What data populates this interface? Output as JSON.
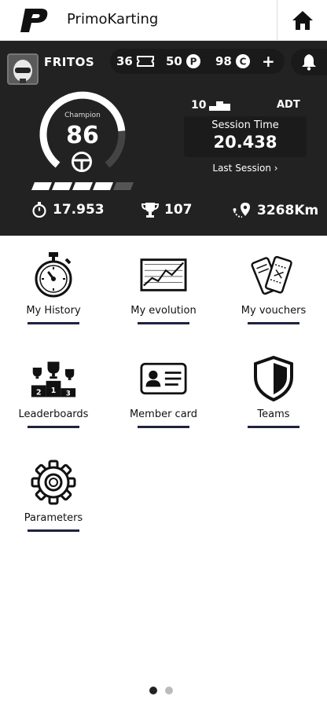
{
  "header": {
    "title": "PrimoKarting",
    "logo_icon": "primo-p-logo",
    "home_icon": "home-icon"
  },
  "profile": {
    "username": "FRITOS",
    "tickets": "36",
    "points": "50",
    "credits": "98",
    "plus": "+",
    "level_label": "Champion",
    "level_value": "86",
    "level_progress": 0.8,
    "level_bars_filled": 4,
    "level_bars_total": 5
  },
  "session": {
    "rank": "10",
    "track": "ADT",
    "label": "Session Time",
    "time": "20.438",
    "link": "Last Session ›"
  },
  "stats": {
    "best_lap": "17.953",
    "trophies": "107",
    "distance": "3268Km"
  },
  "menu": [
    {
      "label": "My History",
      "icon": "stopwatch-icon"
    },
    {
      "label": "My evolution",
      "icon": "line-chart-icon"
    },
    {
      "label": "My vouchers",
      "icon": "tickets-icon"
    },
    {
      "label": "Leaderboards",
      "icon": "podium-icon"
    },
    {
      "label": "Member card",
      "icon": "id-card-icon"
    },
    {
      "label": "Teams",
      "icon": "shield-icon"
    },
    {
      "label": "Parameters",
      "icon": "gear-icon"
    }
  ],
  "pager": {
    "pages": 2,
    "current": 1
  },
  "colors": {
    "dark_panel": "#222222",
    "accent_line": "#1f2240",
    "dot_active": "#222222",
    "dot_inactive": "#bbbbbb"
  }
}
